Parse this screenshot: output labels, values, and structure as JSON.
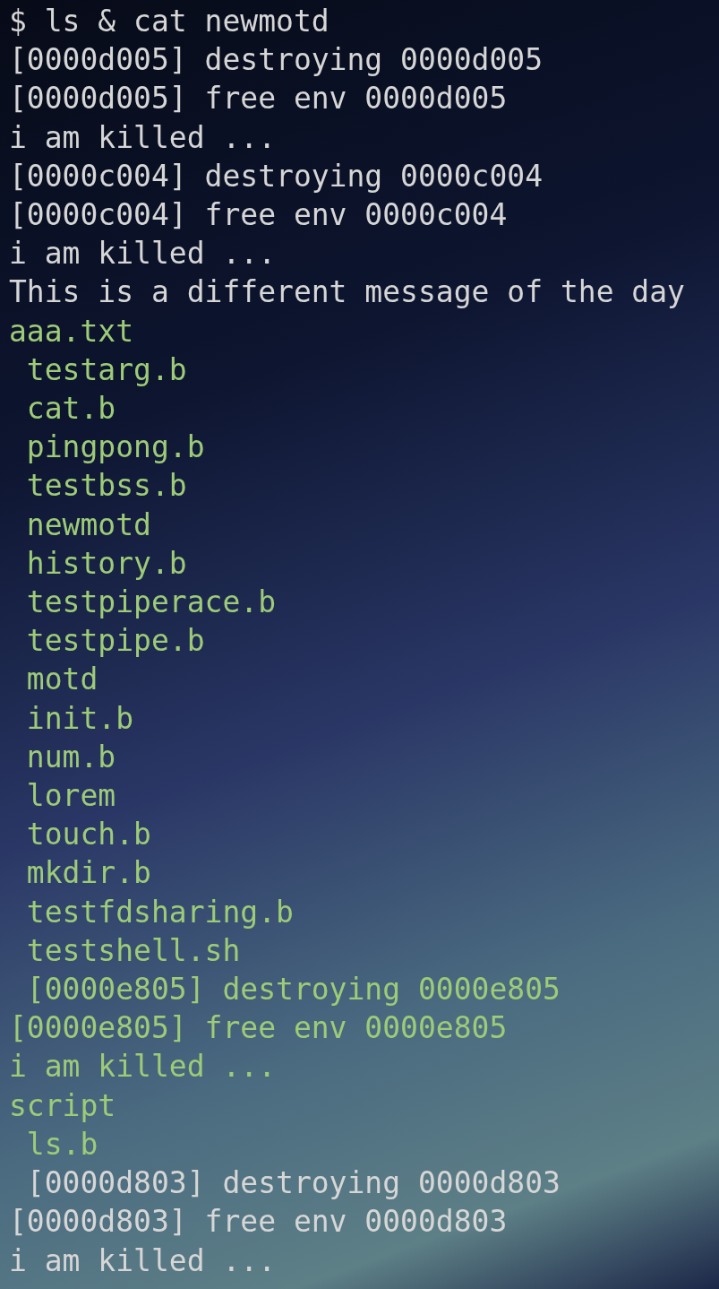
{
  "terminal": {
    "lines": [
      {
        "text": "$ ls & cat newmotd",
        "kind": "output"
      },
      {
        "text": "[0000d005] destroying 0000d005",
        "kind": "output"
      },
      {
        "text": "[0000d005] free env 0000d005",
        "kind": "output"
      },
      {
        "text": "i am killed ...",
        "kind": "output"
      },
      {
        "text": "[0000c004] destroying 0000c004",
        "kind": "output"
      },
      {
        "text": "[0000c004] free env 0000c004",
        "kind": "output"
      },
      {
        "text": "i am killed ...",
        "kind": "output"
      },
      {
        "text": "This is a different message of the day",
        "kind": "output"
      },
      {
        "text": "aaa.txt",
        "kind": "file"
      },
      {
        "text": " testarg.b",
        "kind": "file"
      },
      {
        "text": " cat.b",
        "kind": "file"
      },
      {
        "text": " pingpong.b",
        "kind": "file"
      },
      {
        "text": " testbss.b",
        "kind": "file"
      },
      {
        "text": " newmotd",
        "kind": "file"
      },
      {
        "text": " history.b",
        "kind": "file"
      },
      {
        "text": " testpiperace.b",
        "kind": "file"
      },
      {
        "text": " testpipe.b",
        "kind": "file"
      },
      {
        "text": " motd",
        "kind": "file"
      },
      {
        "text": " init.b",
        "kind": "file"
      },
      {
        "text": " num.b",
        "kind": "file"
      },
      {
        "text": " lorem",
        "kind": "file"
      },
      {
        "text": " touch.b",
        "kind": "file"
      },
      {
        "text": " mkdir.b",
        "kind": "file"
      },
      {
        "text": " testfdsharing.b",
        "kind": "file"
      },
      {
        "text": " testshell.sh",
        "kind": "file"
      },
      {
        "text": " [0000e805] destroying 0000e805",
        "kind": "file"
      },
      {
        "text": "[0000e805] free env 0000e805",
        "kind": "file"
      },
      {
        "text": "i am killed ...",
        "kind": "file"
      },
      {
        "text": "script",
        "kind": "file"
      },
      {
        "text": " ls.b",
        "kind": "file"
      },
      {
        "text": " [0000d803] destroying 0000d803",
        "kind": "output"
      },
      {
        "text": "[0000d803] free env 0000d803",
        "kind": "output"
      },
      {
        "text": "i am killed ...",
        "kind": "output"
      }
    ]
  }
}
